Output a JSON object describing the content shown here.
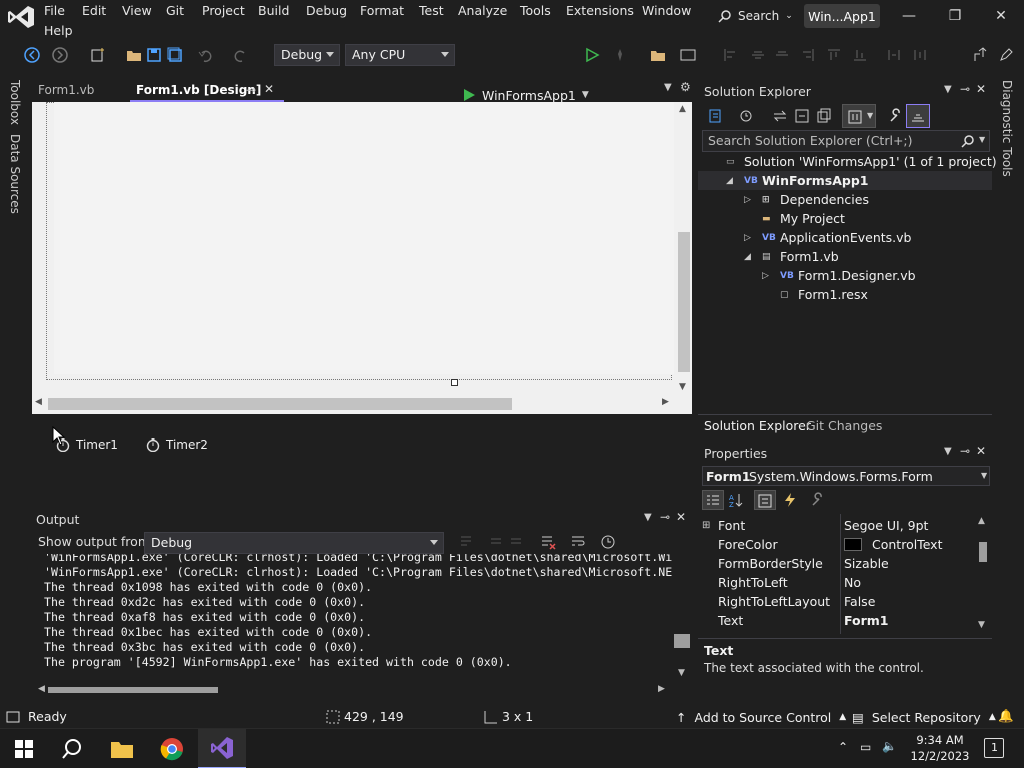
{
  "menu": {
    "items": [
      "File",
      "Edit",
      "View",
      "Git",
      "Project",
      "Build",
      "Debug",
      "Format",
      "Test",
      "Analyze",
      "Tools",
      "Extensions",
      "Window",
      "Help"
    ],
    "search_label": "Search",
    "solution_name": "Win...App1"
  },
  "toolbar": {
    "config": "Debug",
    "platform": "Any CPU",
    "run_target": "WinFormsApp1"
  },
  "side_strips": {
    "left": [
      "Toolbox",
      "Data Sources"
    ],
    "right": [
      "Diagnostic Tools"
    ]
  },
  "doc_tabs": [
    {
      "label": "Form1.vb",
      "active": false
    },
    {
      "label": "Form1.vb [Design]",
      "active": true
    }
  ],
  "tray": {
    "components": [
      "Timer1",
      "Timer2"
    ]
  },
  "output": {
    "title": "Output",
    "show_from_label": "Show output from:",
    "source": "Debug",
    "lines": [
      "'WinFormsApp1.exe' (CoreCLR: clrhost): Loaded 'C:\\Program Files\\dotnet\\shared\\Microsoft.Wi",
      "'WinFormsApp1.exe' (CoreCLR: clrhost): Loaded 'C:\\Program Files\\dotnet\\shared\\Microsoft.NE",
      "The thread 0x1098 has exited with code 0 (0x0).",
      "The thread 0xd2c has exited with code 0 (0x0).",
      "The thread 0xaf8 has exited with code 0 (0x0).",
      "The thread 0x1bec has exited with code 0 (0x0).",
      "The thread 0x3bc has exited with code 0 (0x0).",
      "The program '[4592] WinFormsApp1.exe' has exited with code 0 (0x0)."
    ]
  },
  "solution_explorer": {
    "title": "Solution Explorer",
    "search_placeholder": "Search Solution Explorer (Ctrl+;)",
    "tree": [
      {
        "label": "Solution 'WinFormsApp1' (1 of 1 project)",
        "indent": 0,
        "bold": false,
        "expander": ""
      },
      {
        "label": "WinFormsApp1",
        "indent": 1,
        "bold": true,
        "expander": "◢"
      },
      {
        "label": "Dependencies",
        "indent": 2,
        "bold": false,
        "expander": "▷"
      },
      {
        "label": "My Project",
        "indent": 2,
        "bold": false,
        "expander": ""
      },
      {
        "label": "ApplicationEvents.vb",
        "indent": 2,
        "bold": false,
        "expander": "▷"
      },
      {
        "label": "Form1.vb",
        "indent": 2,
        "bold": false,
        "expander": "◢"
      },
      {
        "label": "Form1.Designer.vb",
        "indent": 3,
        "bold": false,
        "expander": "▷"
      },
      {
        "label": "Form1.resx",
        "indent": 3,
        "bold": false,
        "expander": ""
      }
    ],
    "bottom_tabs": [
      "Solution Explorer",
      "Git Changes"
    ]
  },
  "properties": {
    "title": "Properties",
    "object_name": "Form1",
    "object_type": "System.Windows.Forms.Form",
    "rows": [
      {
        "name": "Font",
        "value": "Segoe UI, 9pt",
        "expandable": true
      },
      {
        "name": "ForeColor",
        "value": "ControlText",
        "swatch": "#000000"
      },
      {
        "name": "FormBorderStyle",
        "value": "Sizable"
      },
      {
        "name": "RightToLeft",
        "value": "No"
      },
      {
        "name": "RightToLeftLayout",
        "value": "False"
      },
      {
        "name": "Text",
        "value": "Form1",
        "bold": true
      }
    ],
    "desc_title": "Text",
    "desc_body": "The text associated with the control."
  },
  "statusbar": {
    "ready": "Ready",
    "position": "429 , 149",
    "size": "3 x 1",
    "source_control": "Add to Source Control",
    "repository": "Select Repository"
  },
  "taskbar": {
    "time": "9:34 AM",
    "date": "12/2/2023",
    "notifications": "1"
  },
  "colors": {
    "accent": "#8c7df4",
    "run_green": "#3fb950"
  }
}
